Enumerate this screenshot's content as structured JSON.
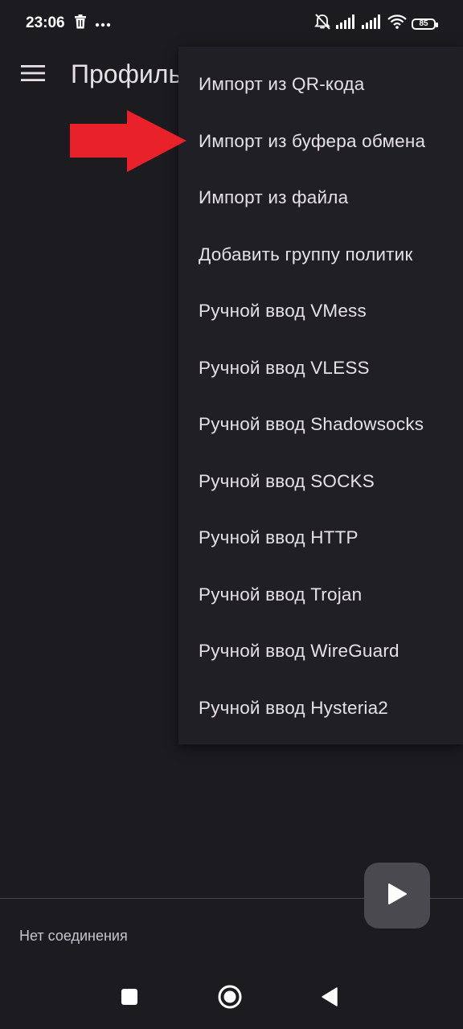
{
  "status_bar": {
    "time": "23:06",
    "left_icons": [
      "trash-icon",
      "more-dots-icon"
    ],
    "right_icons": [
      "bell-off-icon",
      "signal-icon",
      "signal-icon",
      "wifi-icon",
      "battery-icon"
    ],
    "battery_level": "85"
  },
  "app_bar": {
    "title": "Профиль",
    "menu_icon": "hamburger-menu-icon"
  },
  "dropdown_menu": {
    "items": [
      {
        "label": "Импорт из QR-кода"
      },
      {
        "label": "Импорт из буфера обмена"
      },
      {
        "label": "Импорт из файла"
      },
      {
        "label": "Добавить группу политик"
      },
      {
        "label": "Ручной ввод VMess"
      },
      {
        "label": "Ручной ввод VLESS"
      },
      {
        "label": "Ручной ввод Shadowsocks"
      },
      {
        "label": "Ручной ввод SOCKS"
      },
      {
        "label": "Ручной ввод HTTP"
      },
      {
        "label": "Ручной ввод Trojan"
      },
      {
        "label": "Ручной ввод WireGuard"
      },
      {
        "label": "Ручной ввод Hysteria2"
      }
    ]
  },
  "annotation": {
    "arrow_color": "#e8212b",
    "points_to_item": 1
  },
  "bottom": {
    "connection_status": "Нет соединения",
    "fab_icon": "play-icon"
  },
  "nav_bar": {
    "icons": [
      "recents-square-icon",
      "home-circle-icon",
      "back-triangle-icon"
    ]
  },
  "colors": {
    "background": "#1c1b1f",
    "menu_surface": "#211f26",
    "text": "#e6e1e5",
    "fab": "#4a4950"
  }
}
